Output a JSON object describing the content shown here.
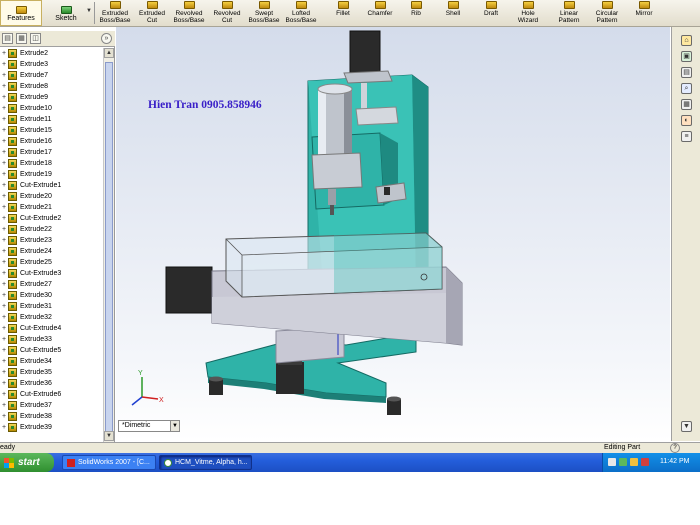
{
  "ribbon": {
    "tabs": [
      {
        "label": "Features"
      },
      {
        "label": "Sketch"
      }
    ],
    "tools": [
      {
        "line1": "Extruded",
        "line2": "Boss/Base"
      },
      {
        "line1": "Extruded",
        "line2": "Cut"
      },
      {
        "line1": "Revolved",
        "line2": "Boss/Base"
      },
      {
        "line1": "Revolved",
        "line2": "Cut"
      },
      {
        "line1": "Swept",
        "line2": "Boss/Base"
      },
      {
        "line1": "Lofted",
        "line2": "Boss/Base"
      },
      {
        "line1": "Fillet",
        "line2": ""
      },
      {
        "line1": "Chamfer",
        "line2": ""
      },
      {
        "line1": "Rib",
        "line2": ""
      },
      {
        "line1": "Shell",
        "line2": ""
      },
      {
        "line1": "Draft",
        "line2": ""
      },
      {
        "line1": "Hole",
        "line2": "Wizard"
      },
      {
        "line1": "Linear",
        "line2": "Pattern"
      },
      {
        "line1": "Circular",
        "line2": "Pattern"
      },
      {
        "line1": "Mirror",
        "line2": ""
      }
    ]
  },
  "feature_tree": {
    "items": [
      "Extrude2",
      "Extrude3",
      "Extrude7",
      "Extrude8",
      "Extrude9",
      "Extrude10",
      "Extrude11",
      "Extrude15",
      "Extrude16",
      "Extrude17",
      "Extrude18",
      "Extrude19",
      "Cut-Extrude1",
      "Extrude20",
      "Extrude21",
      "Cut-Extrude2",
      "Extrude22",
      "Extrude23",
      "Extrude24",
      "Extrude25",
      "Cut-Extrude3",
      "Extrude27",
      "Extrude30",
      "Extrude31",
      "Extrude32",
      "Cut-Extrude4",
      "Extrude33",
      "Cut-Extrude5",
      "Extrude34",
      "Extrude35",
      "Extrude36",
      "Cut-Extrude6",
      "Extrude37",
      "Extrude38",
      "Extrude39"
    ]
  },
  "viewport": {
    "watermark": "Hien Tran 0905.858946",
    "view_orientation": "*Dimetric",
    "colors": {
      "frame": "#2fb3a8",
      "table": "#c8c8d4",
      "dark": "#2a2a2a"
    }
  },
  "status_bar": {
    "left_text": "eady",
    "right_text": "Editing Part"
  },
  "taskbar": {
    "start_label": "start",
    "windows": [
      {
        "label": "SolidWorks 2007 - [C..."
      },
      {
        "label": "HCM_Vitme, Alpha, h..."
      }
    ],
    "clock": "11:42 PM"
  }
}
